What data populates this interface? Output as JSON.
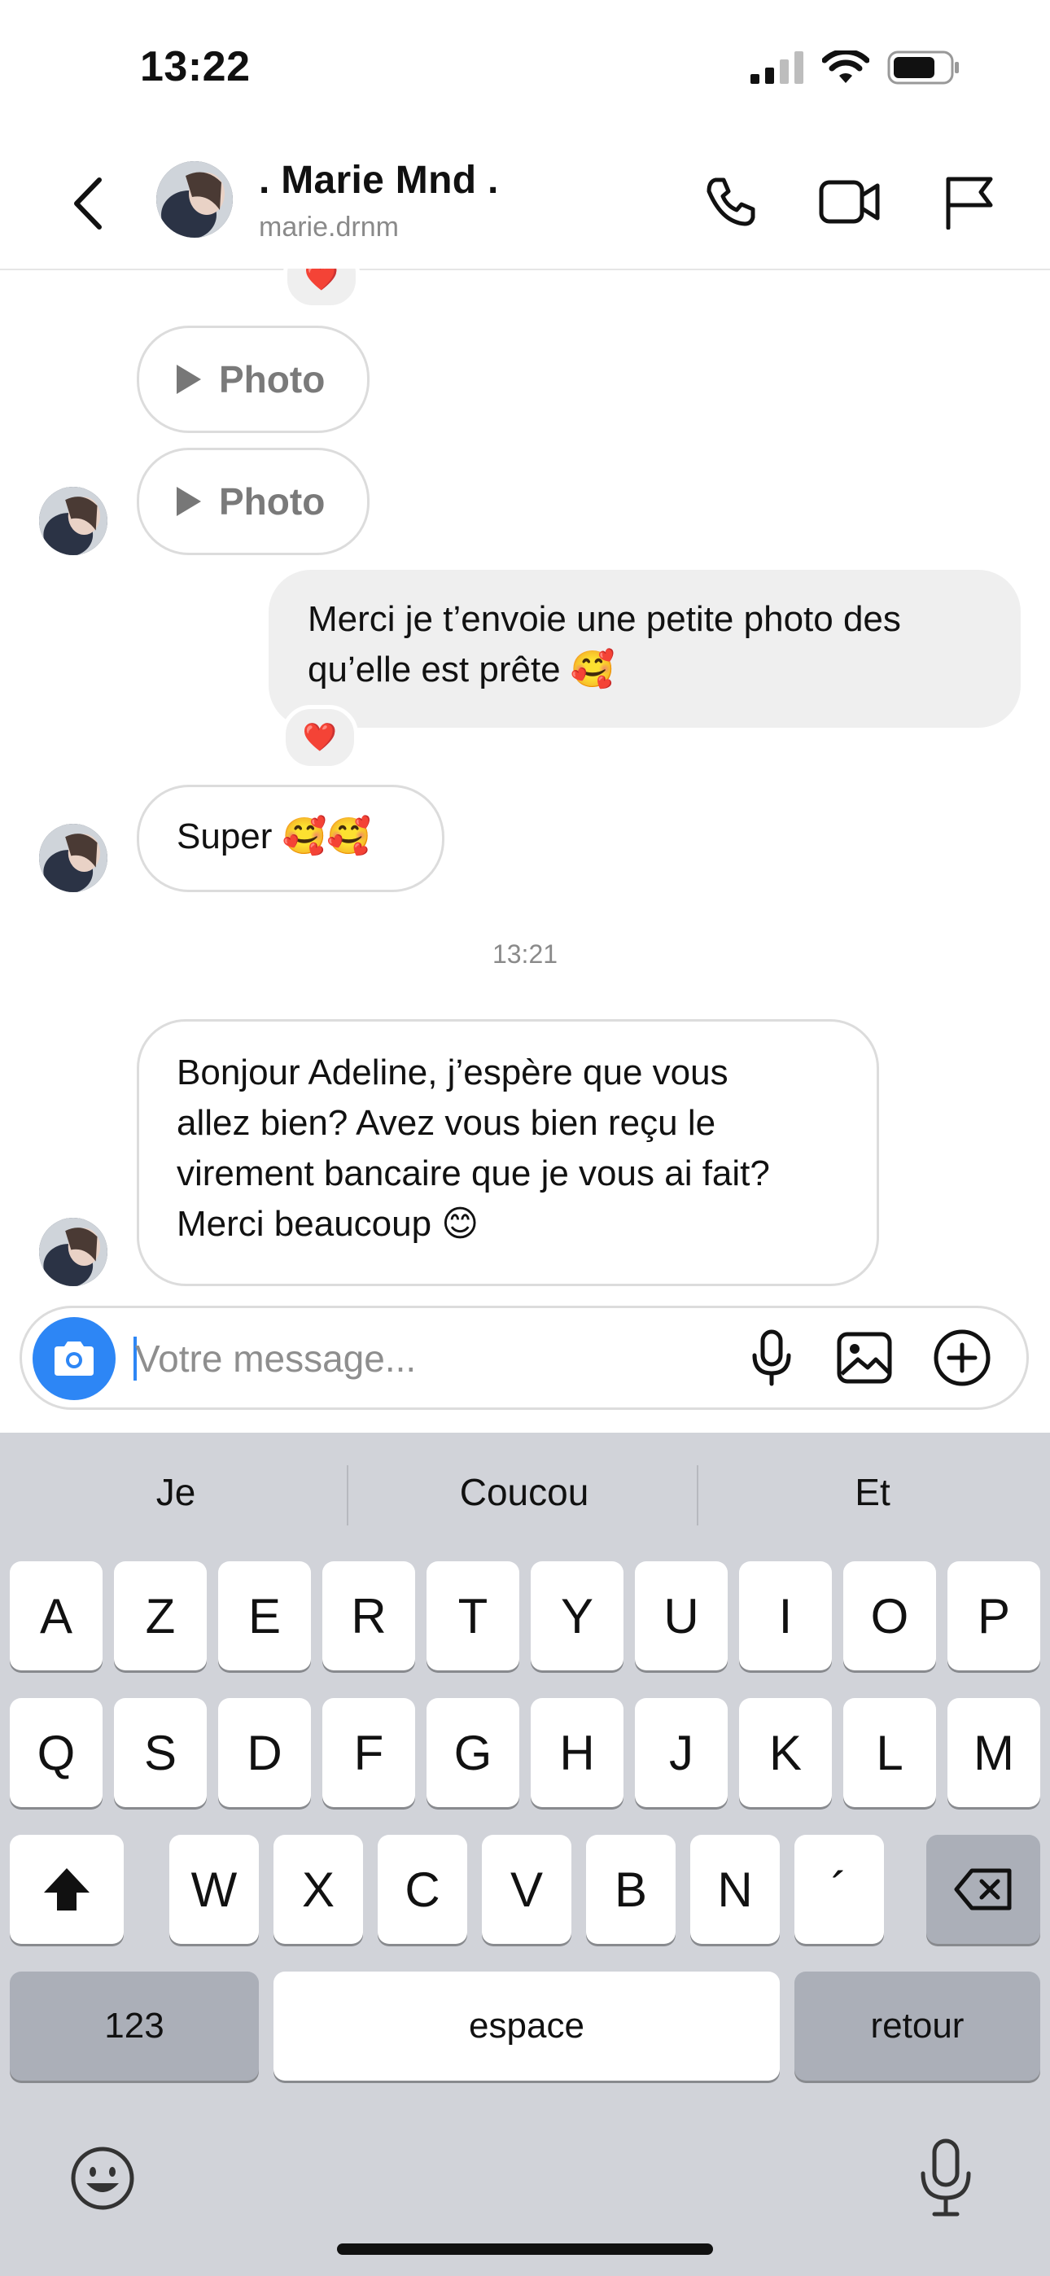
{
  "status_bar": {
    "time": "13:22"
  },
  "header": {
    "display_name": ". Marie Mnd .",
    "username": "marie.drnm"
  },
  "messages": {
    "photo_label": "Photo",
    "outgoing_1": {
      "line1": "Merci je t’envoie une petite photo des",
      "line2": "qu’elle est prête 🥰",
      "reaction": "❤️"
    },
    "top_reaction": "❤️",
    "incoming_super": "Super 🥰🥰",
    "timestamp": "13:21",
    "incoming_last": {
      "line1": "Bonjour Adeline, j’espère que vous",
      "line2": "allez bien? Avez vous bien reçu le",
      "line3": "virement bancaire que je vous ai fait?",
      "line4": "Merci beaucoup 😊"
    }
  },
  "composer": {
    "placeholder": "Votre message..."
  },
  "keyboard": {
    "suggestions": [
      "Je",
      "Coucou",
      "Et"
    ],
    "row1": [
      "A",
      "Z",
      "E",
      "R",
      "T",
      "Y",
      "U",
      "I",
      "O",
      "P"
    ],
    "row2": [
      "Q",
      "S",
      "D",
      "F",
      "G",
      "H",
      "J",
      "K",
      "L",
      "M"
    ],
    "row3": [
      "W",
      "X",
      "C",
      "V",
      "B",
      "N",
      "´"
    ],
    "numbers_label": "123",
    "space_label": "espace",
    "return_label": "retour"
  }
}
